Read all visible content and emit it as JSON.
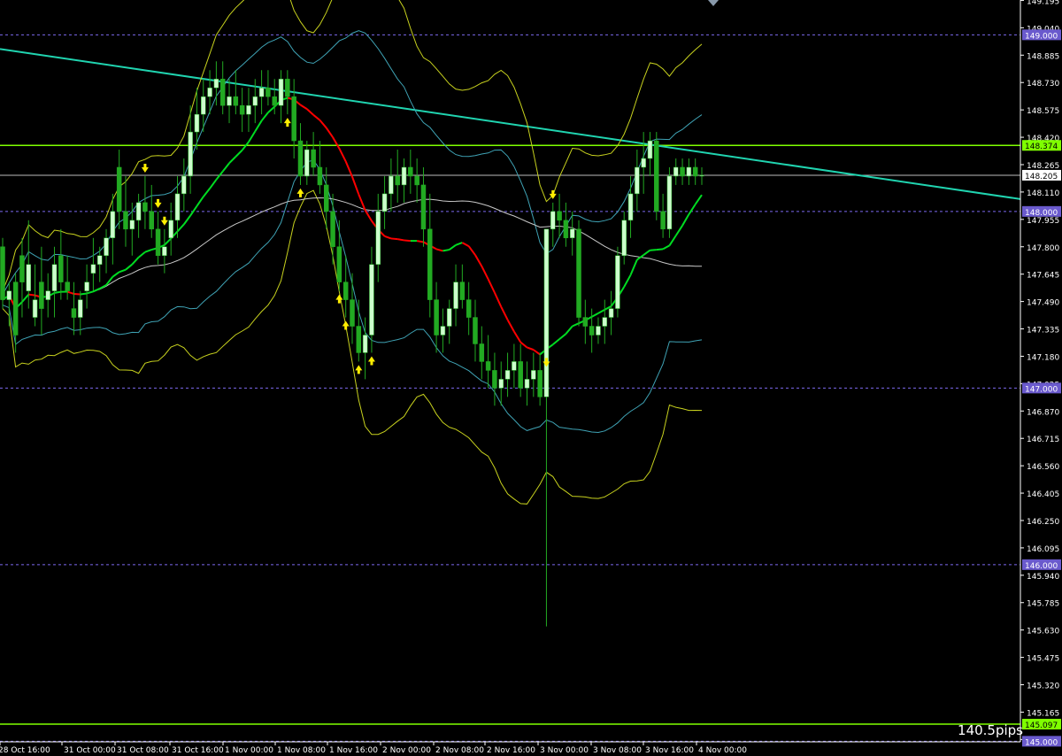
{
  "chart_data": {
    "type": "candlestick",
    "title": "",
    "xlabel": "",
    "ylabel": "",
    "ylim": [
      145.0,
      149.25
    ],
    "y_ticks": [
      "149.195",
      "149.040",
      "148.885",
      "148.730",
      "148.575",
      "148.420",
      "148.265",
      "148.110",
      "147.955",
      "147.800",
      "147.645",
      "147.490",
      "147.335",
      "147.180",
      "147.025",
      "146.870",
      "146.715",
      "146.560",
      "146.405",
      "146.250",
      "146.095",
      "145.940",
      "145.785",
      "145.630",
      "145.475",
      "145.320",
      "145.165",
      "145.010"
    ],
    "x_ticks": [
      "28 Oct 16:00",
      "31 Oct 00:00",
      "31 Oct 08:00",
      "31 Oct 16:00",
      "1 Nov 00:00",
      "1 Nov 08:00",
      "1 Nov 16:00",
      "2 Nov 00:00",
      "2 Nov 08:00",
      "2 Nov 16:00",
      "3 Nov 00:00",
      "3 Nov 08:00",
      "3 Nov 16:00",
      "4 Nov 00:00"
    ],
    "price_level_badges": [
      {
        "label": "149.000",
        "value": 149.0,
        "color": "#7b68ee"
      },
      {
        "label": "148.374",
        "value": 148.374,
        "color": "#7fff00"
      },
      {
        "label": "148.205",
        "value": 148.205,
        "color": "#ffffff"
      },
      {
        "label": "148.000",
        "value": 148.0,
        "color": "#7b68ee"
      },
      {
        "label": "147.000",
        "value": 147.0,
        "color": "#7b68ee"
      },
      {
        "label": "146.000",
        "value": 146.0,
        "color": "#7b68ee"
      },
      {
        "label": "145.097",
        "value": 145.097,
        "color": "#7fff00"
      },
      {
        "label": "145.000",
        "value": 145.0,
        "color": "#7b68ee"
      }
    ],
    "candles_ohlc": [
      [
        147.8,
        147.85,
        147.45,
        147.5
      ],
      [
        147.5,
        147.6,
        147.35,
        147.55
      ],
      [
        147.6,
        147.65,
        147.2,
        147.3
      ],
      [
        147.75,
        147.85,
        147.4,
        147.6
      ],
      [
        147.55,
        147.95,
        147.45,
        147.7
      ],
      [
        147.4,
        147.7,
        147.35,
        147.5
      ],
      [
        147.6,
        147.8,
        147.3,
        147.45
      ],
      [
        147.5,
        147.65,
        147.4,
        147.55
      ],
      [
        147.55,
        147.8,
        147.4,
        147.7
      ],
      [
        147.75,
        147.9,
        147.5,
        147.6
      ],
      [
        147.6,
        147.75,
        147.5,
        147.55
      ],
      [
        147.45,
        147.6,
        147.3,
        147.4
      ],
      [
        147.4,
        147.55,
        147.3,
        147.5
      ],
      [
        147.55,
        147.7,
        147.45,
        147.6
      ],
      [
        147.65,
        147.85,
        147.55,
        147.7
      ],
      [
        147.7,
        147.8,
        147.6,
        147.75
      ],
      [
        147.75,
        147.9,
        147.65,
        147.85
      ],
      [
        147.85,
        148.1,
        147.7,
        148.0
      ],
      [
        148.25,
        148.35,
        147.9,
        148.0
      ],
      [
        148.0,
        148.2,
        147.8,
        147.9
      ],
      [
        147.9,
        148.05,
        147.75,
        147.95
      ],
      [
        147.95,
        148.1,
        147.85,
        148.05
      ],
      [
        148.05,
        148.2,
        147.9,
        148.0
      ],
      [
        148.0,
        148.15,
        147.85,
        147.9
      ],
      [
        147.9,
        148.0,
        147.7,
        147.75
      ],
      [
        147.75,
        147.9,
        147.65,
        147.8
      ],
      [
        147.85,
        148.05,
        147.75,
        147.95
      ],
      [
        147.95,
        148.2,
        147.85,
        148.1
      ],
      [
        148.1,
        148.3,
        148.0,
        148.2
      ],
      [
        148.2,
        148.6,
        148.1,
        148.45
      ],
      [
        148.45,
        148.7,
        148.35,
        148.55
      ],
      [
        148.55,
        148.75,
        148.45,
        148.65
      ],
      [
        148.65,
        148.8,
        148.55,
        148.7
      ],
      [
        148.7,
        148.85,
        148.6,
        148.75
      ],
      [
        148.75,
        148.85,
        148.55,
        148.6
      ],
      [
        148.6,
        148.75,
        148.5,
        148.65
      ],
      [
        148.65,
        148.8,
        148.55,
        148.6
      ],
      [
        148.6,
        148.7,
        148.45,
        148.55
      ],
      [
        148.55,
        148.7,
        148.45,
        148.6
      ],
      [
        148.6,
        148.75,
        148.5,
        148.65
      ],
      [
        148.65,
        148.8,
        148.55,
        148.7
      ],
      [
        148.7,
        148.8,
        148.6,
        148.65
      ],
      [
        148.65,
        148.75,
        148.55,
        148.6
      ],
      [
        148.6,
        148.8,
        148.5,
        148.75
      ],
      [
        148.75,
        148.8,
        148.55,
        148.65
      ],
      [
        148.65,
        148.75,
        148.3,
        148.4
      ],
      [
        148.4,
        148.5,
        148.15,
        148.2
      ],
      [
        148.2,
        148.4,
        148.15,
        148.35
      ],
      [
        148.35,
        148.45,
        148.2,
        148.25
      ],
      [
        148.25,
        148.4,
        148.1,
        148.15
      ],
      [
        148.15,
        148.25,
        147.9,
        148.0
      ],
      [
        148.0,
        148.1,
        147.7,
        147.8
      ],
      [
        147.8,
        147.95,
        147.55,
        147.6
      ],
      [
        147.6,
        147.75,
        147.4,
        147.5
      ],
      [
        147.5,
        147.65,
        147.25,
        147.35
      ],
      [
        147.35,
        147.5,
        147.15,
        147.2
      ],
      [
        147.2,
        147.4,
        147.05,
        147.3
      ],
      [
        147.3,
        147.8,
        147.2,
        147.7
      ],
      [
        147.7,
        148.1,
        147.6,
        148.0
      ],
      [
        148.0,
        148.2,
        147.9,
        148.1
      ],
      [
        148.1,
        148.3,
        148.0,
        148.2
      ],
      [
        148.2,
        148.35,
        148.05,
        148.15
      ],
      [
        148.15,
        148.3,
        148.05,
        148.25
      ],
      [
        148.25,
        148.35,
        148.1,
        148.2
      ],
      [
        148.2,
        148.3,
        148.05,
        148.15
      ],
      [
        148.15,
        148.25,
        147.8,
        147.9
      ],
      [
        147.9,
        148.1,
        147.4,
        147.5
      ],
      [
        147.5,
        147.6,
        147.2,
        147.3
      ],
      [
        147.3,
        147.45,
        147.2,
        147.35
      ],
      [
        147.35,
        147.5,
        147.25,
        147.45
      ],
      [
        147.45,
        147.7,
        147.35,
        147.6
      ],
      [
        147.6,
        147.7,
        147.45,
        147.5
      ],
      [
        147.5,
        147.6,
        147.3,
        147.4
      ],
      [
        147.4,
        147.5,
        147.15,
        147.25
      ],
      [
        147.25,
        147.35,
        147.05,
        147.15
      ],
      [
        147.15,
        147.3,
        147.0,
        147.1
      ],
      [
        147.1,
        147.2,
        146.9,
        147.0
      ],
      [
        147.0,
        147.15,
        146.9,
        147.05
      ],
      [
        147.05,
        147.2,
        146.95,
        147.1
      ],
      [
        147.1,
        147.25,
        147.0,
        147.15
      ],
      [
        147.15,
        147.25,
        146.95,
        147.0
      ],
      [
        147.0,
        147.15,
        146.9,
        147.05
      ],
      [
        147.05,
        147.2,
        146.95,
        147.1
      ],
      [
        147.1,
        147.2,
        146.9,
        146.95
      ],
      [
        146.95,
        147.1,
        145.65,
        147.9
      ],
      [
        147.9,
        148.05,
        147.8,
        148.0
      ],
      [
        148.0,
        148.1,
        147.85,
        147.95
      ],
      [
        147.95,
        148.05,
        147.8,
        147.85
      ],
      [
        147.85,
        148.0,
        147.75,
        147.9
      ],
      [
        147.9,
        147.95,
        147.35,
        147.4
      ],
      [
        147.4,
        147.5,
        147.25,
        147.35
      ],
      [
        147.35,
        147.45,
        147.2,
        147.3
      ],
      [
        147.3,
        147.4,
        147.25,
        147.35
      ],
      [
        147.35,
        147.5,
        147.25,
        147.4
      ],
      [
        147.4,
        147.55,
        147.3,
        147.45
      ],
      [
        147.45,
        147.8,
        147.4,
        147.75
      ],
      [
        147.75,
        148.0,
        147.7,
        147.95
      ],
      [
        147.95,
        148.2,
        147.85,
        148.1
      ],
      [
        148.1,
        148.35,
        148.0,
        148.25
      ],
      [
        148.25,
        148.45,
        148.1,
        148.3
      ],
      [
        148.3,
        148.45,
        148.2,
        148.4
      ],
      [
        148.4,
        148.45,
        147.95,
        148.0
      ],
      [
        148.0,
        148.1,
        147.85,
        147.9
      ],
      [
        147.9,
        148.25,
        147.85,
        148.2
      ],
      [
        148.2,
        148.3,
        148.15,
        148.25
      ],
      [
        148.25,
        148.3,
        148.15,
        148.2
      ],
      [
        148.2,
        148.3,
        148.15,
        148.25
      ],
      [
        148.25,
        148.3,
        148.15,
        148.2
      ],
      [
        148.2,
        148.25,
        148.15,
        148.205
      ]
    ]
  },
  "trendline": {
    "color": "#20d4b0"
  },
  "pips_label": "140.5pips",
  "colors": {
    "bull": "#ccffcc",
    "bear": "#22aa22",
    "grid": "#7b68ee",
    "bb_outer": "#c8d21e",
    "bb_inner": "#3fa3b5",
    "ma_slow": "#c8c8c8",
    "ma_up": "#00dd22",
    "ma_down": "#ff0000",
    "arrow": "#ffee00",
    "axis_text": "#ffffff",
    "level_line": "#7fff00"
  }
}
